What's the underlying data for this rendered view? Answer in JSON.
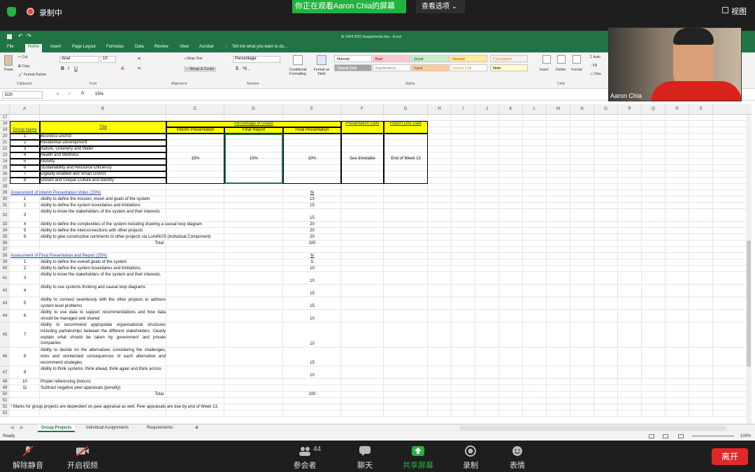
{
  "zoom": {
    "recording_label": "录制中",
    "share_banner": "你正在观看Aaron Chia的屏幕",
    "view_options": "查看选项",
    "view_label": "视图",
    "participant_count": "44",
    "bottom": [
      "解除静音",
      "开启视频",
      "参会者",
      "聊天",
      "共享屏幕",
      "录制",
      "表情"
    ],
    "leave": "离开",
    "video_name": "Aaron Chia"
  },
  "excel": {
    "file_title": "IE 5404 2021 Assignments.xlsx - Excel",
    "tabs": [
      "File",
      "Home",
      "Insert",
      "Page Layout",
      "Formulas",
      "Data",
      "Review",
      "View",
      "Acrobat"
    ],
    "tell_me": "Tell me what you want to do...",
    "clipboard": {
      "cut": "Cut",
      "copy": "Copy",
      "format_painter": "Format Painter",
      "paste": "Paste"
    },
    "font_name": "Arial",
    "font_size": "10",
    "wrap_text": "Wrap Text",
    "merge_center": "Merge & Center",
    "number_format": "Percentage",
    "conditional": "Conditional Formatting",
    "format_as_table": "Format as Table",
    "styles": {
      "normal": "Normal",
      "bad": "Bad",
      "good": "Good",
      "neutral": "Neutral",
      "calculation": "Calculation",
      "check": "Check Cell",
      "explanatory": "Explanatory ...",
      "input": "Input",
      "linked": "Linked Cell",
      "note": "Note"
    },
    "cells_group": {
      "insert": "Insert",
      "delete": "Delete",
      "format": "Format"
    },
    "editing": {
      "auto": "Auto",
      "fill": "Fill",
      "clear": "Clea"
    },
    "group_labels": [
      "Clipboard",
      "Font",
      "Alignment",
      "Number",
      "Styles",
      "Cells"
    ],
    "name_box": "D20",
    "formula": "15%",
    "columns": [
      "A",
      "B",
      "C",
      "D",
      "E",
      "F",
      "G",
      "H",
      "I",
      "J",
      "K",
      "L",
      "M",
      "N",
      "O",
      "P",
      "Q",
      "R",
      "S"
    ],
    "rows": [
      "17",
      "18",
      "19",
      "20",
      "21",
      "22",
      "23",
      "24",
      "25",
      "26",
      "27",
      "28",
      "29",
      "30",
      "31",
      "32",
      "33",
      "34",
      "35",
      "36",
      "37",
      "38",
      "39",
      "40",
      "41",
      "42",
      "43",
      "44",
      "45",
      "46",
      "47",
      "48",
      "49",
      "50",
      "51",
      "52",
      "53"
    ],
    "headers": {
      "title": "Title",
      "group_name": "Group Name",
      "pct_grade": "Percentage of Grade",
      "interim": "Interim Presentation",
      "final_report": "Final Report",
      "final_pres": "Final Presentation",
      "pres_date": "Presentation Date",
      "report_due": "Report Due Date"
    },
    "groups": [
      {
        "n": "1",
        "t": "Business District"
      },
      {
        "n": "2",
        "t": "Residential Development"
      },
      {
        "n": "3",
        "t": "Nature, Greenery and Water"
      },
      {
        "n": "4",
        "t": "Health and Wellness"
      },
      {
        "n": "5",
        "t": "Mobility"
      },
      {
        "n": "6",
        "t": "Sustainability and Resource Efficiency"
      },
      {
        "n": "7",
        "t": "Digitally enabled and Smart District"
      },
      {
        "n": "8",
        "t": "Vibrant and Unique Culture and Identity"
      }
    ],
    "grade": {
      "interim": "15%",
      "report": "15%",
      "final": "10%",
      "date": "See timetable",
      "due": "End of Week 13"
    },
    "interim_title": "Assessment of Interim Presentation Video (15%)",
    "pct": "%",
    "interim_items": [
      {
        "n": "1",
        "t": "Ability to define the mission, vision and goals of the system",
        "v": "10"
      },
      {
        "n": "2",
        "t": "Ability to define the system boundaries and limitations",
        "v": "15"
      },
      {
        "n": "3",
        "t": "Ability to know the stakeholders of the system and their interests",
        "v": "15"
      },
      {
        "n": "4",
        "t": "Ability to define the complexities of the system including drawing a causal loop diagram",
        "v": "20"
      },
      {
        "n": "5",
        "t": "Ability to define the interconnections with other projects",
        "v": "20"
      },
      {
        "n": "6",
        "t": "Ability to give constructive comments to other projects via LumiNUS (Individual Component)",
        "v": "20"
      }
    ],
    "total_label": "Total",
    "total_value": "100",
    "final_title": "Assessment of Final Presentation and Report (25%)",
    "final_items": [
      {
        "n": "1",
        "t": "Ability to define the overall goals of the system",
        "v": "5"
      },
      {
        "n": "2",
        "t": "Ability to define the system boundaries and limitations.",
        "v": "10"
      },
      {
        "n": "3",
        "t": "Ability to know the stakeholders of the system and their interests.",
        "v": "10"
      },
      {
        "n": "4",
        "t": "Ability to use systems thinking and causal loop diagrams",
        "v": "15"
      },
      {
        "n": "5",
        "t": "Ability to connect seamlessly with the other projects to address system level problems",
        "v": "15"
      },
      {
        "n": "6",
        "t": "Ability to use data to support recommendations and how data should be managed and shared",
        "v": "10"
      },
      {
        "n": "7",
        "t": "Ability to recommend appropriate organisational structures including partnerships between the different stakeholders. Clearly explain what should be taken by government and private companies",
        "v": "10"
      },
      {
        "n": "8",
        "t": "Ability to decide on the alternatives considering the challenges, risks and unintended consequences of each alternative and recommend strategies",
        "v": "15"
      },
      {
        "n": "9",
        "t": "Ability to think systems, think ahead, think again and think across",
        "v": "10"
      },
      {
        "n": "10",
        "t": "Proper referencing (bonus)",
        "v": ""
      },
      {
        "n": "11",
        "t": "Subtract negative peer appraisals (penalty)",
        "v": ""
      }
    ],
    "footnote": "* Marks for group projects are dependent on peer appraisal as well. Peer appraisals are due by end of Week 13.",
    "sheet_tabs": [
      "Group Projects",
      "Individual Assignments",
      "Requirements"
    ],
    "status": "Ready",
    "zoom_pct": "100%"
  }
}
